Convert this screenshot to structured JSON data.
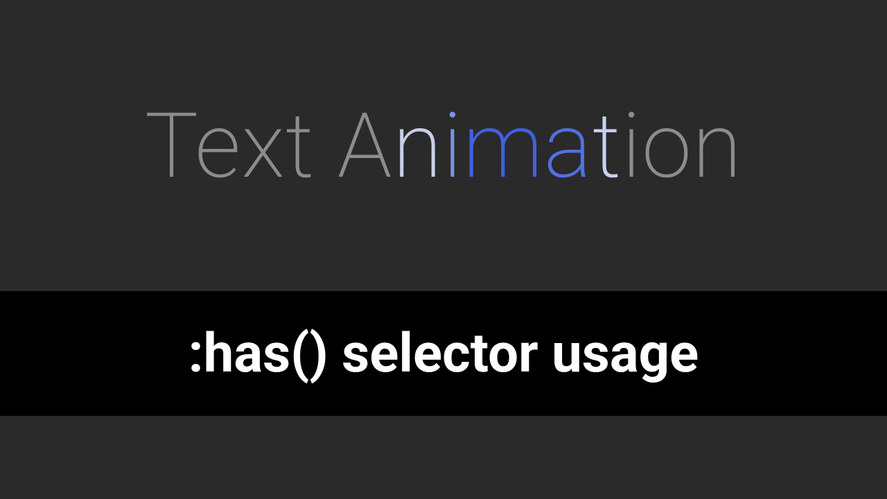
{
  "hero": {
    "letters": [
      {
        "char": "T",
        "color": "#8c8c8c"
      },
      {
        "char": "e",
        "color": "#8c8c8c"
      },
      {
        "char": "x",
        "color": "#8c8c8c"
      },
      {
        "char": "t",
        "color": "#8c8c8c"
      },
      {
        "char": " ",
        "color": "#8c8c8c"
      },
      {
        "char": "A",
        "color": "#8c8c8c"
      },
      {
        "char": "n",
        "color": "#c8cfe6"
      },
      {
        "char": "i",
        "color": "#7e93e4"
      },
      {
        "char": "m",
        "color": "#4161e0"
      },
      {
        "char": "a",
        "color": "#5170e3"
      },
      {
        "char": "t",
        "color": "#c9d1ef"
      },
      {
        "char": "i",
        "color": "#8c8c8c"
      },
      {
        "char": "o",
        "color": "#8c8c8c"
      },
      {
        "char": "n",
        "color": "#8c8c8c"
      }
    ]
  },
  "banner": {
    "title": ":has() selector usage"
  },
  "colors": {
    "background": "#2a2a2a",
    "banner_bg": "#000000",
    "banner_text": "#ffffff"
  }
}
